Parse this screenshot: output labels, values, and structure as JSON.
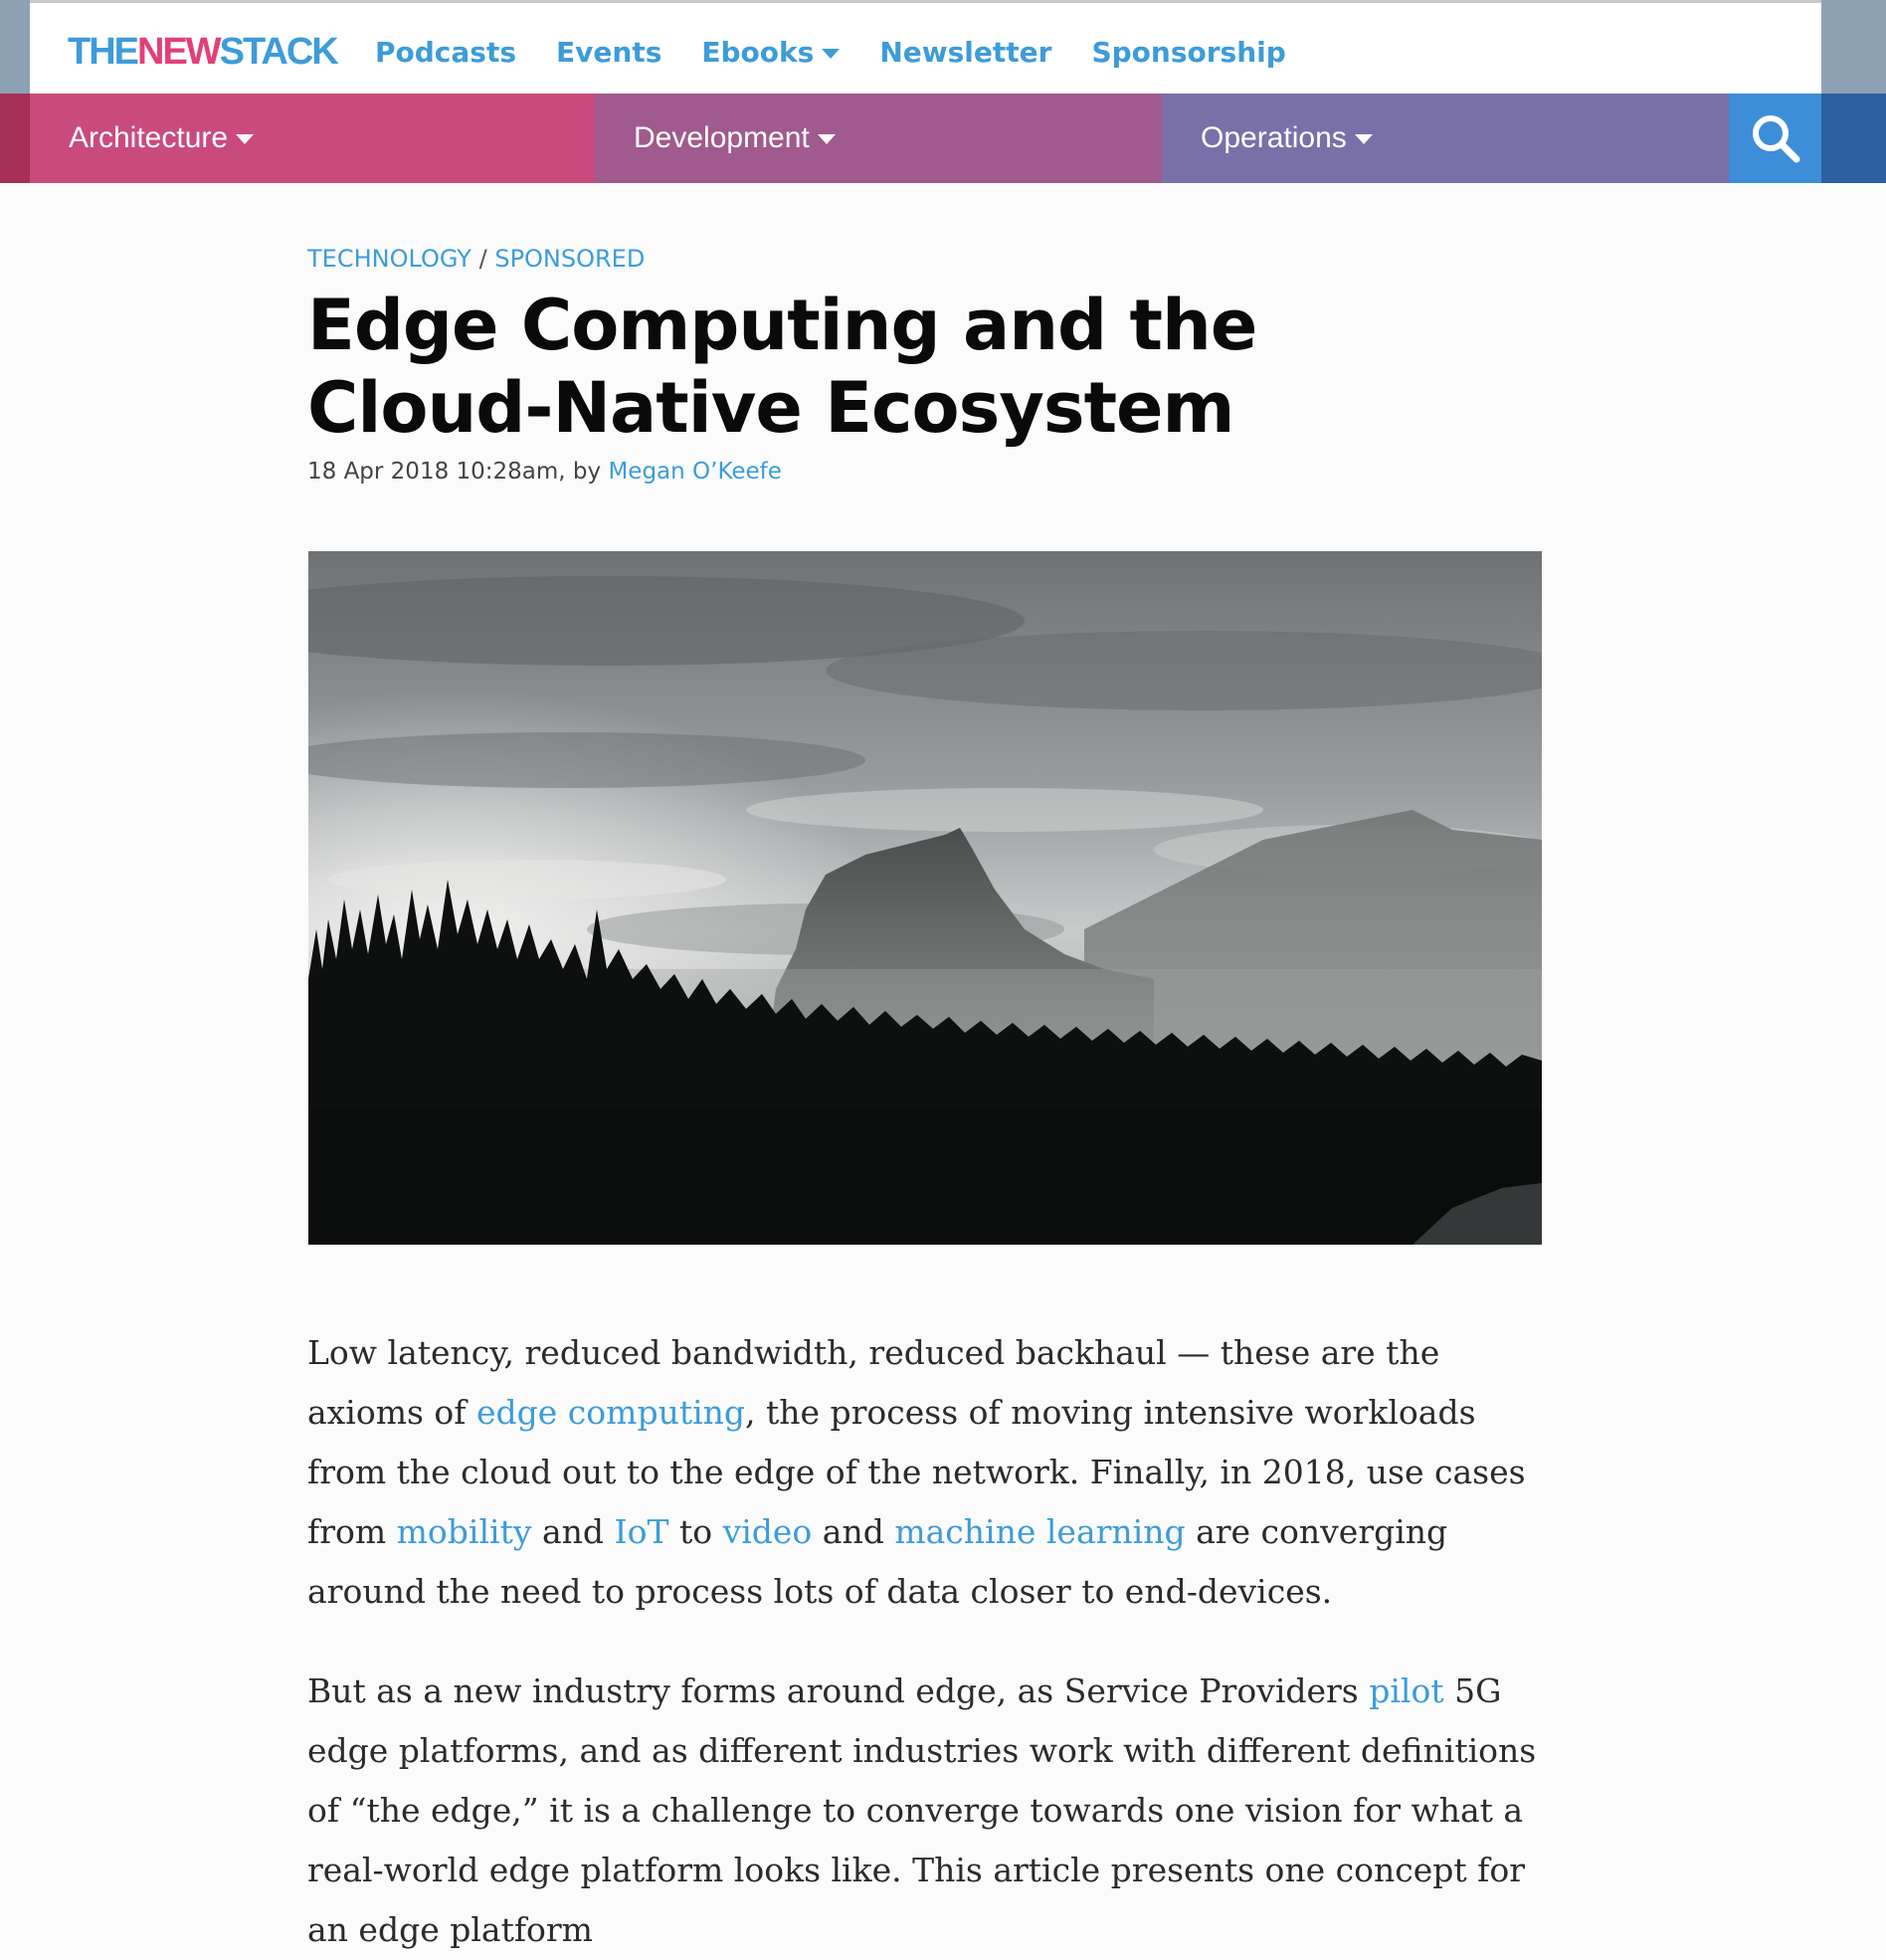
{
  "logo": {
    "the": "THE",
    "new": "NEW",
    "stack": "STACK"
  },
  "top_nav": [
    {
      "label": "Podcasts"
    },
    {
      "label": "Events"
    },
    {
      "label": "Ebooks"
    },
    {
      "label": "Newsletter"
    },
    {
      "label": "Sponsorship"
    }
  ],
  "categories": [
    {
      "label": "Architecture",
      "color": "#c94b7d"
    },
    {
      "label": "Development",
      "color": "#a05a8d"
    },
    {
      "label": "Operations",
      "color": "#7a70a8"
    }
  ],
  "search_icon": "search-icon",
  "article": {
    "crumb_technology": "TECHNOLOGY",
    "crumb_separator": "/",
    "crumb_sponsored": "SPONSORED",
    "title": "Edge Computing and the Cloud-Native Ecosystem",
    "date": "18 Apr 2018 10:28am, by",
    "author": "Megan O’Keefe",
    "p1": {
      "t1": "Low latency, reduced bandwidth, reduced backhaul — these are the axioms of ",
      "l1": "edge computing",
      "t2": ", the process of moving intensive workloads from the cloud out to the edge of the network. Finally, in 2018, use cases from ",
      "l2": "mobility",
      "t3": " and ",
      "l3": "IoT",
      "t4": " to ",
      "l4": "video",
      "t5": " and ",
      "l5": "machine learning",
      "t6": " are converging around the need to process lots of data closer to end-devices."
    },
    "p2": {
      "t1": "But as a new industry forms around edge, as Service Providers ",
      "l1": "pilot",
      "t2": " 5G edge platforms, and as different industries work with different definitions of “the edge,” it is a challenge to converge towards one vision for what a real-world edge platform looks like. This article presents one concept for an edge platform"
    }
  },
  "colors": {
    "link_blue": "#3d9cd8",
    "brand_pink": "#e23f77",
    "search_blue": "#3d8ed8"
  }
}
